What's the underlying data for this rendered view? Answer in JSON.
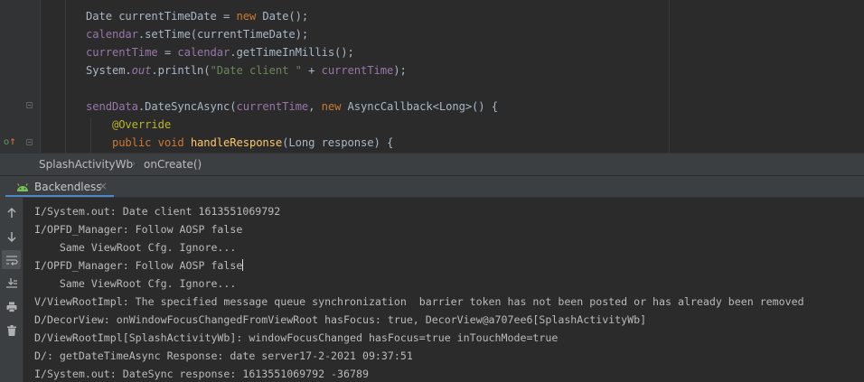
{
  "editor": {
    "lines": [
      [
        {
          "t": "Date currentTimeDate = ",
          "c": "plain"
        },
        {
          "t": "new ",
          "c": "kw"
        },
        {
          "t": "Date();",
          "c": "plain"
        }
      ],
      [
        {
          "t": "calendar",
          "c": "field"
        },
        {
          "t": ".setTime(currentTimeDate);",
          "c": "plain"
        }
      ],
      [
        {
          "t": "currentTime",
          "c": "field"
        },
        {
          "t": " = ",
          "c": "plain"
        },
        {
          "t": "calendar",
          "c": "field"
        },
        {
          "t": ".getTimeInMillis();",
          "c": "plain"
        }
      ],
      [
        {
          "t": "System.",
          "c": "plain"
        },
        {
          "t": "out",
          "c": "static"
        },
        {
          "t": ".println(",
          "c": "plain"
        },
        {
          "t": "\"Date client \"",
          "c": "str"
        },
        {
          "t": " + ",
          "c": "plain"
        },
        {
          "t": "currentTime",
          "c": "field"
        },
        {
          "t": ");",
          "c": "plain"
        }
      ],
      [],
      [
        {
          "t": "sendData",
          "c": "field"
        },
        {
          "t": ".DateSyncAsync(",
          "c": "plain"
        },
        {
          "t": "currentTime",
          "c": "field"
        },
        {
          "t": ", ",
          "c": "plain"
        },
        {
          "t": "new ",
          "c": "kw"
        },
        {
          "t": "AsyncCallback<Long>() {",
          "c": "plain"
        }
      ],
      [
        {
          "t": "    ",
          "c": "plain"
        },
        {
          "t": "@Override",
          "c": "ann"
        }
      ],
      [
        {
          "t": "    ",
          "c": "plain"
        },
        {
          "t": "public void ",
          "c": "kw"
        },
        {
          "t": "handleResponse",
          "c": "method"
        },
        {
          "t": "(Long response) {",
          "c": "plain"
        }
      ]
    ],
    "colors": {
      "plain": "#a9b7c6",
      "kw": "#cc7832",
      "field": "#9876aa",
      "static": "#9876aa",
      "str": "#6a8759",
      "ann": "#bbb529",
      "method": "#ffc66d"
    }
  },
  "breadcrumb": {
    "items": [
      "SplashActivityWb",
      "onCreate()"
    ],
    "separator": "›"
  },
  "tool_window": {
    "tab_label": "Backendless",
    "tab_icon": "android-icon",
    "close_glyph": "×",
    "accent": "#4a88c7"
  },
  "side_toolbar": {
    "icons": [
      "arrow-up-icon",
      "arrow-down-icon",
      "soft-wrap-icon",
      "scroll-to-end-icon",
      "print-icon",
      "trash-icon"
    ]
  },
  "logcat": {
    "lines": [
      "I/System.out: Date client 1613551069792",
      "I/OPFD_Manager: Follow AOSP false",
      "    Same ViewRoot Cfg. Ignore...",
      "I/OPFD_Manager: Follow AOSP false",
      "    Same ViewRoot Cfg. Ignore...",
      "V/ViewRootImpl: The specified message queue synchronization  barrier token has not been posted or has already been removed",
      "D/DecorView: onWindowFocusChangedFromViewRoot hasFocus: true, DecorView@a707ee6[SplashActivityWb]",
      "D/ViewRootImpl[SplashActivityWb]: windowFocusChanged hasFocus=true inTouchMode=true",
      "D/: getDateTimeAsync Response: date server17-2-2021 09:37:51",
      "I/System.out: DateSync response: 1613551069792 -36789"
    ]
  }
}
